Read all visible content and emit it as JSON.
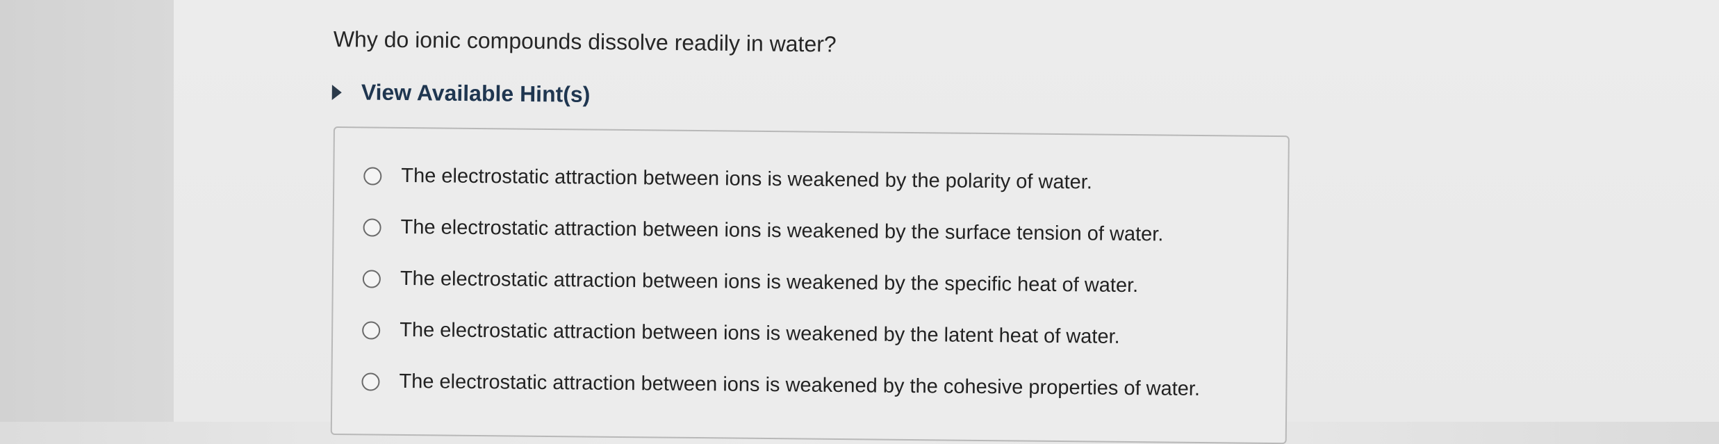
{
  "question": {
    "text": "Why do ionic compounds dissolve readily in water?"
  },
  "hint": {
    "label": "View Available Hint(s)",
    "icon": "triangle-right-icon"
  },
  "options": [
    {
      "label": "The electrostatic attraction between ions is weakened by the polarity of water.",
      "selected": false
    },
    {
      "label": "The electrostatic attraction between ions is weakened by the surface tension of water.",
      "selected": false
    },
    {
      "label": "The electrostatic attraction between ions is weakened by the specific heat of water.",
      "selected": false
    },
    {
      "label": "The electrostatic attraction between ions is weakened by the latent heat of water.",
      "selected": false
    },
    {
      "label": "The electrostatic attraction between ions is weakened by the cohesive properties of water.",
      "selected": false
    }
  ]
}
